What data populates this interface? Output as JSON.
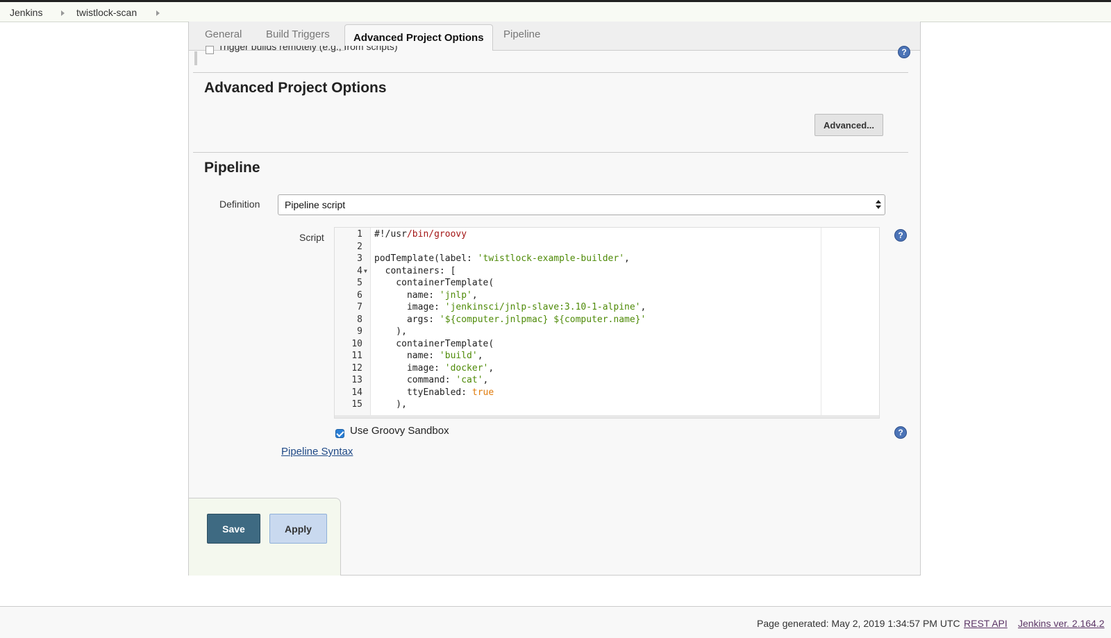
{
  "breadcrumb": {
    "items": [
      "Jenkins",
      "twistlock-scan"
    ]
  },
  "tabs": [
    "General",
    "Build Triggers",
    "Advanced Project Options",
    "Pipeline"
  ],
  "trigger_remote_label": "Trigger builds remotely (e.g., from scripts)",
  "advanced_section": {
    "title": "Advanced Project Options",
    "button_label": "Advanced..."
  },
  "pipeline": {
    "title": "Pipeline",
    "definition_label": "Definition",
    "definition_value": "Pipeline script",
    "script_label": "Script",
    "script_lines": [
      "#!/usr/bin/groovy",
      "",
      "podTemplate(label: 'twistlock-example-builder',",
      "  containers: [",
      "    containerTemplate(",
      "      name: 'jnlp',",
      "      image: 'jenkinsci/jnlp-slave:3.10-1-alpine',",
      "      args: '${computer.jnlpmac} ${computer.name}'",
      "    ),",
      "    containerTemplate(",
      "      name: 'build',",
      "      image: 'docker',",
      "      command: 'cat',",
      "      ttyEnabled: true",
      "    ),"
    ],
    "sandbox_label": "Use Groovy Sandbox",
    "sandbox_checked": true,
    "syntax_link": "Pipeline Syntax"
  },
  "buttons": {
    "save": "Save",
    "apply": "Apply"
  },
  "footer": {
    "page_generated": "Page generated: May 2, 2019 1:34:57 PM UTC",
    "rest_api": "REST API",
    "version": "Jenkins ver. 2.164.2"
  },
  "icons": {
    "help": "help-icon",
    "breadcrumb_separator": "chevron-right-icon",
    "fold": "fold-arrow-icon",
    "checkbox": "checkbox-icon"
  },
  "colors": {
    "save_button": "#3e6a82",
    "apply_button": "#c9d9ef",
    "link": "#204a87",
    "string": "#4e8a07",
    "keyword": "#e07b0b",
    "help_icon": "#4c74b7"
  }
}
